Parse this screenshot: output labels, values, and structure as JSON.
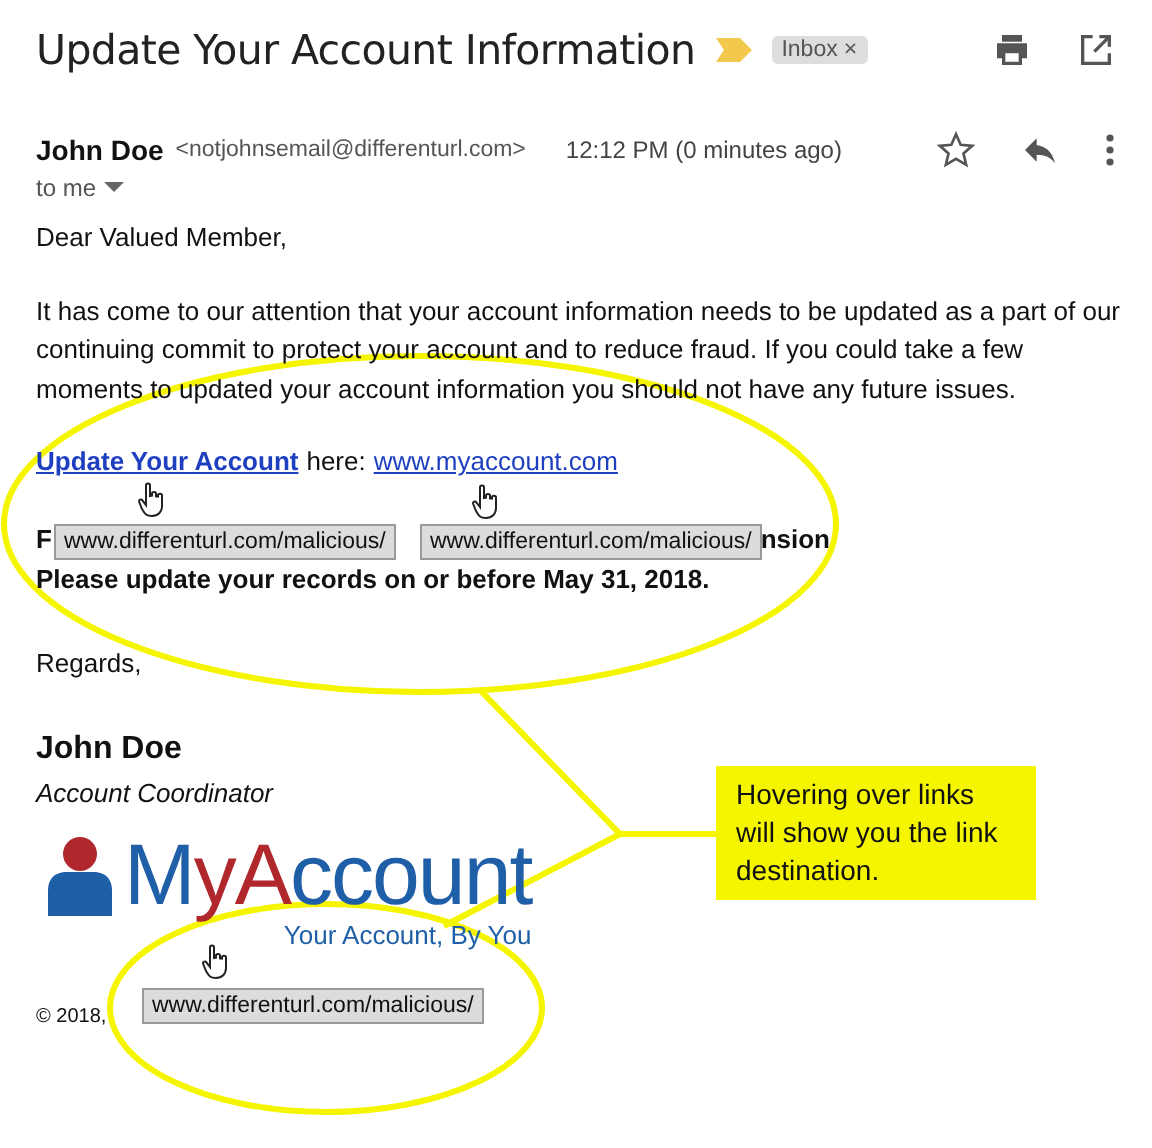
{
  "header": {
    "subject": "Update Your Account Information",
    "label": {
      "text": "Inbox",
      "close": "×"
    }
  },
  "message": {
    "sender_name": "John Doe",
    "sender_email": "<notjohnsemail@differenturl.com>",
    "time": "12:12 PM (0 minutes ago)",
    "recipient": "to me"
  },
  "body": {
    "greeting": "Dear Valued Member,",
    "paragraph": "It has come to our attention that your account information needs to be updated as a part of our continuing commit to protect your account and to reduce fraud. If you could take a few moments to updated your account information you should not have any future issues.",
    "link_line": {
      "link": "Update Your Account",
      "text": "here:",
      "url": "www.myaccount.com"
    },
    "covered_line": {
      "start": "F",
      "end": "nsion"
    },
    "warning_line": "Please update your records on or before May 31, 2018.",
    "closing": "Regards,",
    "signature": {
      "name": "John Doe",
      "title": "Account Coordinator"
    },
    "logo": {
      "parts": [
        {
          "text": "M",
          "color": "#1f5fa8"
        },
        {
          "text": "yA",
          "color": "#b0282c"
        },
        {
          "text": "ccount",
          "color": "#1f5fa8"
        }
      ],
      "tagline": "Your Account, By You"
    },
    "footer": "© 2018,"
  },
  "tooltips": [
    "www.differenturl.com/malicious/",
    "www.differenturl.com/malicious/",
    "www.differenturl.com/malicious/"
  ],
  "callout": "Hovering over links will show you the link destination."
}
